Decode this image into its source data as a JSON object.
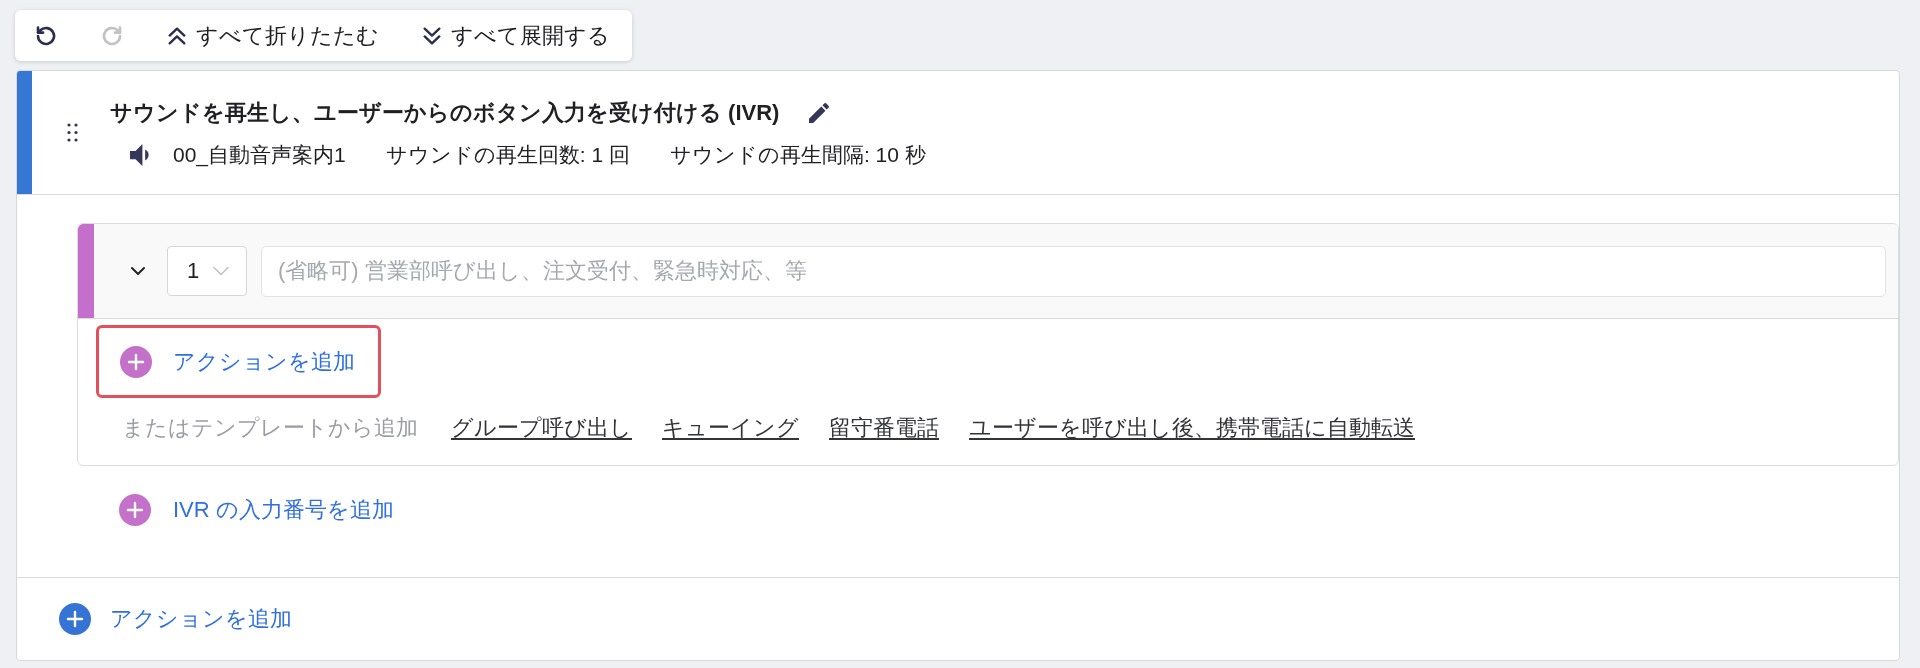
{
  "toolbar": {
    "buttons": [
      {
        "kind": "undo",
        "disabled": false
      },
      {
        "kind": "redo",
        "disabled": true
      },
      {
        "kind": "collapse_all",
        "label": "すべて折りたたむ",
        "disabled": false
      },
      {
        "kind": "expand_all",
        "label": "すべて展開する",
        "disabled": false
      }
    ]
  },
  "ivr_step": {
    "title": "サウンドを再生し、ユーザーからのボタン入力を受け付ける (IVR)",
    "sound": "00_自動音声案内1",
    "play_count": "サウンドの再生回数: 1 回",
    "play_interval": "サウンドの再生間隔: 10 秒",
    "options": [
      {
        "expanded": true,
        "number": "1",
        "placeholder": "(省略可) 営業部呼び出し、注文受付、緊急時対応、等",
        "add_action": {
          "label": "アクションを追加",
          "highlighted": true
        },
        "template_prompt": "またはテンプレートから追加",
        "templates": [
          "グループ呼び出し",
          "キューイング",
          "留守番電話",
          "ユーザーを呼び出し後、携帯電話に自動転送"
        ]
      }
    ],
    "add_option": "IVR の入力番号を追加"
  },
  "add_action": "アクションを追加"
}
